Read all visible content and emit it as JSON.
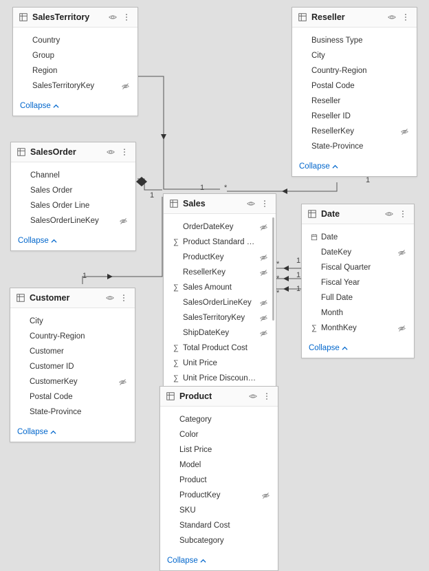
{
  "collapse_label": "Collapse",
  "tables": {
    "salesTerritory": {
      "title": "SalesTerritory",
      "fields": [
        {
          "name": "Country",
          "icon": "",
          "hidden": false
        },
        {
          "name": "Group",
          "icon": "",
          "hidden": false
        },
        {
          "name": "Region",
          "icon": "",
          "hidden": false
        },
        {
          "name": "SalesTerritoryKey",
          "icon": "",
          "hidden": true
        }
      ]
    },
    "reseller": {
      "title": "Reseller",
      "fields": [
        {
          "name": "Business Type",
          "icon": "",
          "hidden": false
        },
        {
          "name": "City",
          "icon": "",
          "hidden": false
        },
        {
          "name": "Country-Region",
          "icon": "",
          "hidden": false
        },
        {
          "name": "Postal Code",
          "icon": "",
          "hidden": false
        },
        {
          "name": "Reseller",
          "icon": "",
          "hidden": false
        },
        {
          "name": "Reseller ID",
          "icon": "",
          "hidden": false
        },
        {
          "name": "ResellerKey",
          "icon": "",
          "hidden": true
        },
        {
          "name": "State-Province",
          "icon": "",
          "hidden": false
        }
      ]
    },
    "salesOrder": {
      "title": "SalesOrder",
      "fields": [
        {
          "name": "Channel",
          "icon": "",
          "hidden": false
        },
        {
          "name": "Sales Order",
          "icon": "",
          "hidden": false
        },
        {
          "name": "Sales Order Line",
          "icon": "",
          "hidden": false
        },
        {
          "name": "SalesOrderLineKey",
          "icon": "",
          "hidden": true
        }
      ]
    },
    "sales": {
      "title": "Sales",
      "fields": [
        {
          "name": "OrderDateKey",
          "icon": "",
          "hidden": true
        },
        {
          "name": "Product Standard Cost",
          "icon": "sum",
          "hidden": false
        },
        {
          "name": "ProductKey",
          "icon": "",
          "hidden": true
        },
        {
          "name": "ResellerKey",
          "icon": "",
          "hidden": true
        },
        {
          "name": "Sales Amount",
          "icon": "sum",
          "hidden": false
        },
        {
          "name": "SalesOrderLineKey",
          "icon": "",
          "hidden": true
        },
        {
          "name": "SalesTerritoryKey",
          "icon": "",
          "hidden": true
        },
        {
          "name": "ShipDateKey",
          "icon": "",
          "hidden": true
        },
        {
          "name": "Total Product Cost",
          "icon": "sum",
          "hidden": false
        },
        {
          "name": "Unit Price",
          "icon": "sum",
          "hidden": false
        },
        {
          "name": "Unit Price Discount Pct",
          "icon": "sum",
          "hidden": false
        }
      ]
    },
    "date": {
      "title": "Date",
      "fields": [
        {
          "name": "Date",
          "icon": "date",
          "hidden": false
        },
        {
          "name": "DateKey",
          "icon": "",
          "hidden": true
        },
        {
          "name": "Fiscal Quarter",
          "icon": "",
          "hidden": false
        },
        {
          "name": "Fiscal Year",
          "icon": "",
          "hidden": false
        },
        {
          "name": "Full Date",
          "icon": "",
          "hidden": false
        },
        {
          "name": "Month",
          "icon": "",
          "hidden": false
        },
        {
          "name": "MonthKey",
          "icon": "sum",
          "hidden": true
        }
      ]
    },
    "customer": {
      "title": "Customer",
      "fields": [
        {
          "name": "City",
          "icon": "",
          "hidden": false
        },
        {
          "name": "Country-Region",
          "icon": "",
          "hidden": false
        },
        {
          "name": "Customer",
          "icon": "",
          "hidden": false
        },
        {
          "name": "Customer ID",
          "icon": "",
          "hidden": false
        },
        {
          "name": "CustomerKey",
          "icon": "",
          "hidden": true
        },
        {
          "name": "Postal Code",
          "icon": "",
          "hidden": false
        },
        {
          "name": "State-Province",
          "icon": "",
          "hidden": false
        }
      ]
    },
    "product": {
      "title": "Product",
      "fields": [
        {
          "name": "Category",
          "icon": "",
          "hidden": false
        },
        {
          "name": "Color",
          "icon": "",
          "hidden": false
        },
        {
          "name": "List Price",
          "icon": "",
          "hidden": false
        },
        {
          "name": "Model",
          "icon": "",
          "hidden": false
        },
        {
          "name": "Product",
          "icon": "",
          "hidden": false
        },
        {
          "name": "ProductKey",
          "icon": "",
          "hidden": true
        },
        {
          "name": "SKU",
          "icon": "",
          "hidden": false
        },
        {
          "name": "Standard Cost",
          "icon": "",
          "hidden": false
        },
        {
          "name": "Subcategory",
          "icon": "",
          "hidden": false
        }
      ]
    }
  },
  "relationships": {
    "labels": {
      "one": "1",
      "many": "*"
    }
  }
}
